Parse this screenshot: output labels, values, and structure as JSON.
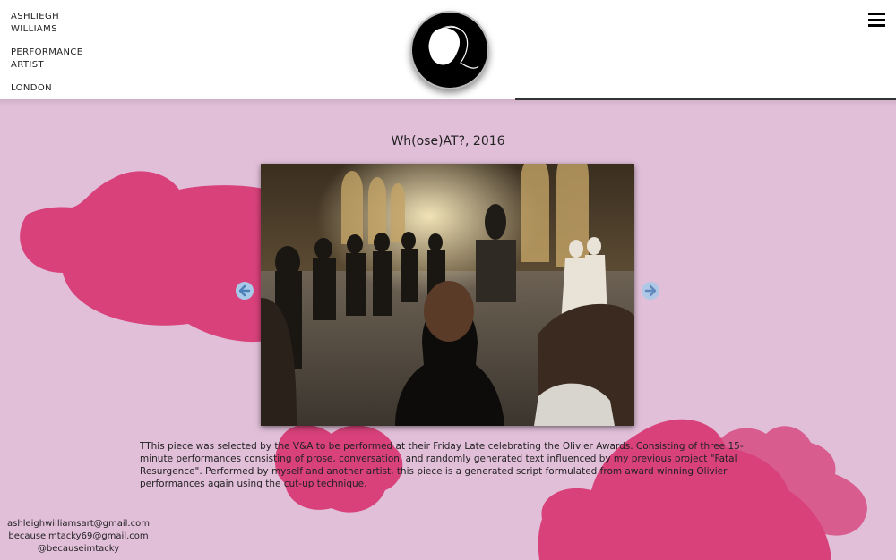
{
  "brand": {
    "name": "ASHLIEGH\nWILLIAMS",
    "role": "PERFORMANCE\nARTIST",
    "location": "LONDON"
  },
  "colors": {
    "background": "#e1bfd9",
    "blob_primary": "#d8417a",
    "blob_secondary": "#d95c8e",
    "arrow": "#a8c9e8"
  },
  "header": {
    "menu_icon": "hamburger-menu-icon"
  },
  "work": {
    "title": "Wh(ose)AT?, 2016",
    "description": "TThis piece was selected by the V&A to be performed at their Friday Late celebrating the Olivier Awards. Consisting of three 15-minute performances consisting of prose, conversation, and randomly generated text influenced by my previous project \"Fatal Resurgence\". Performed by myself and another artist, this piece is a generated script formulated from award winning Olivier performances again using the cut-up technique."
  },
  "slider": {
    "prev_icon": "arrow-left-icon",
    "next_icon": "arrow-right-icon"
  },
  "contact": {
    "email_1": "ashleighwilliamsart@gmail.com",
    "email_2": "becauseimtacky69@gmail.com",
    "handle": "@becauseimtacky"
  }
}
